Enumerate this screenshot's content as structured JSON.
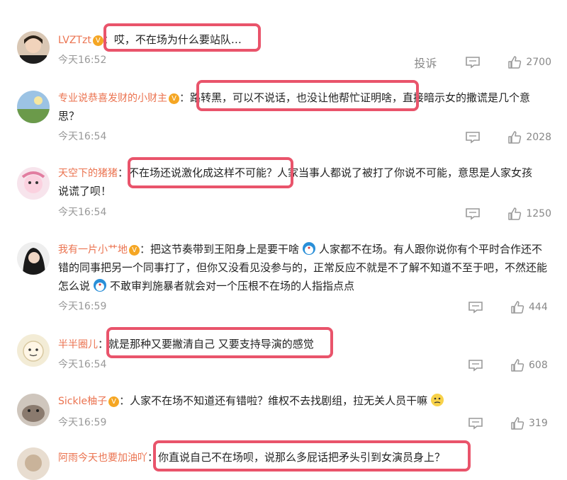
{
  "ui": {
    "report_label": "投诉"
  },
  "comments": [
    {
      "user": "LVZTzt",
      "sep": "：",
      "text": "哎，不在场为什么要站队…",
      "time": "今天16:52",
      "likes": "2700"
    },
    {
      "user": "专业说恭喜发财的小财主",
      "sep": "：",
      "text_hl": "路转黑，可以不说话，也没让他帮忙证明啥，",
      "text_rest": "直接暗示女的撒谎是几个意",
      "text_line2": "思？",
      "time": "今天16:54",
      "likes": "2028"
    },
    {
      "user": "天空下的猪猪",
      "sep": "：",
      "text_hl": "不在场还说激化成这样不可能？",
      "text_rest": "人家当事人都说了被打了你说不可能，意思是人家女孩",
      "text_line2": "说谎了呗！",
      "time": "今天16:54",
      "likes": "1250"
    },
    {
      "user": "我有一片小艹地",
      "sep": "：",
      "text_a": "把这节奏带到王阳身上是要干啥",
      "text_b": "人家都不在场。有人跟你说你有个平时合作还不",
      "text_line2": "错的同事把另一个同事打了，但你又没看见没参与的，正常反应不就是不了解不知道不至于吧，不然还能",
      "text_line3a": "怎么说",
      "text_line3b": "不敢审判施暴者就会对一个压根不在场的人指指点点",
      "time": "今天16:59",
      "likes": "444"
    },
    {
      "user": "半半圈儿",
      "sep": "：",
      "text": "就是那种又要撇清自己 又要支持导演的感觉",
      "time": "今天16:54",
      "likes": "608"
    },
    {
      "user": "Sickle柚子",
      "sep": "：",
      "text": "人家不在场不知道还有错啦？维权不去找剧组，拉无关人员干嘛",
      "time": "今天16:59",
      "likes": "319"
    },
    {
      "user": "阿雨今天也要加油吖",
      "sep": "：",
      "text": "你直说自己不在场呗，说那么多屁话把矛头引到女演员身上？"
    }
  ],
  "badge_label": "V",
  "colors": {
    "username": "#eb7350",
    "highlight": "#e9546b",
    "meta": "#999999"
  },
  "icons": {
    "reply": "comment-icon",
    "like": "thumbs-up-icon"
  }
}
